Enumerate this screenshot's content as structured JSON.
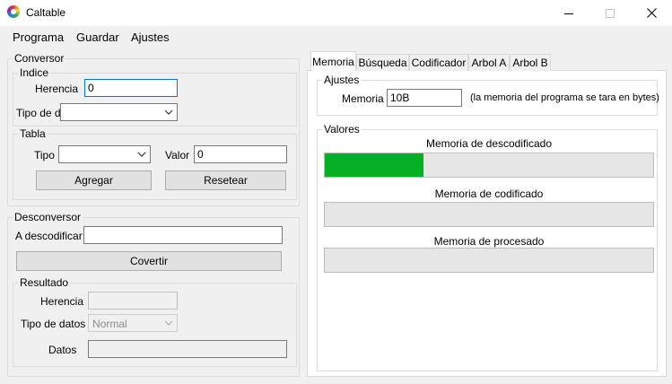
{
  "window": {
    "title": "Caltable",
    "minimize_icon": "minimize-icon",
    "maximize_icon": "maximize-icon",
    "close_icon": "close-icon"
  },
  "menu": [
    "Programa",
    "Guardar",
    "Ajustes"
  ],
  "conversor": {
    "legend": "Conversor",
    "indice": {
      "legend": "Indice",
      "herencia_label": "Herencia",
      "herencia_value": "0",
      "tipo_datos_label": "Tipo de datos",
      "tipo_datos_value": ""
    },
    "tabla": {
      "legend": "Tabla",
      "tipo_label": "Tipo",
      "tipo_value": "",
      "valor_label": "Valor",
      "valor_value": "0",
      "agregar": "Agregar",
      "resetear": "Resetear"
    }
  },
  "desconversor": {
    "legend": "Desconversor",
    "a_descodificar_label": "A descodificar",
    "a_descodificar_value": "",
    "convertir": "Covertir",
    "resultado": {
      "legend": "Resultado",
      "herencia_label": "Herencia",
      "herencia_value": "",
      "tipo_datos_label": "Tipo de datos",
      "tipo_datos_value": "Normal",
      "datos_label": "Datos",
      "datos_value": ""
    }
  },
  "tabs": [
    "Memoria",
    "Búsqueda",
    "Codificador",
    "Arbol A",
    "Arbol B"
  ],
  "memoria": {
    "ajustes": {
      "legend": "Ajustes",
      "memoria_label": "Memoria",
      "memoria_value": "10B",
      "note": "(la memoria del programa se tara en bytes)"
    },
    "valores": {
      "legend": "Valores",
      "bars": [
        {
          "label": "Memoria de descodificado",
          "progress": 0.3
        },
        {
          "label": "Memoria de codificado",
          "progress": 0
        },
        {
          "label": "Memoria de procesado",
          "progress": 0
        }
      ]
    }
  },
  "colors": {
    "progress_fill": "#06b025",
    "focus_border": "#0078d7"
  }
}
